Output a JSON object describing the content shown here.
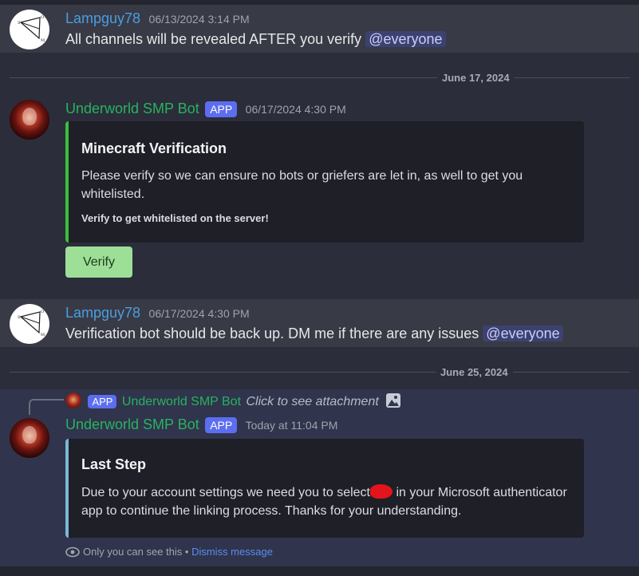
{
  "messages": [
    {
      "author": "Lampguy78",
      "timestamp": "06/13/2024 3:14 PM",
      "text": "All channels will be revealed AFTER you verify",
      "mention": "@everyone"
    },
    {
      "author": "Underworld SMP Bot",
      "tag": "APP",
      "timestamp": "06/17/2024 4:30 PM",
      "embed": {
        "title": "Minecraft Verification",
        "description": "Please verify so we can ensure no bots or griefers are let in, as well to get you whitelisted.",
        "footer": "Verify to get whitelisted on the server!",
        "accent": "#3bbf3b"
      },
      "button": "Verify"
    },
    {
      "author": "Lampguy78",
      "timestamp": "06/17/2024 4:30 PM",
      "text": "Verification bot should be back up. DM me if there are any issues",
      "mention": "@everyone"
    },
    {
      "author": "Underworld SMP Bot",
      "tag": "APP",
      "timestamp": "Today at 11:04 PM",
      "reply": {
        "tag": "APP",
        "author": "Underworld SMP Bot",
        "text": "Click to see attachment",
        "icon": "image-icon"
      },
      "embed": {
        "title": "Last Step",
        "description_before": "Due to your account settings we need you to select",
        "description_after": "in your Microsoft authenticator app to continue the linking process. Thanks for your understanding.",
        "accent": "#7ab8d8"
      },
      "ephemeral": {
        "icon": "eye-icon",
        "text": "Only you can see this •",
        "link": "Dismiss message"
      }
    }
  ],
  "dividers": [
    "June 17, 2024",
    "June 25, 2024"
  ],
  "colors": {
    "background": "#2b2d3a",
    "lampguy_name": "#4a9ee0",
    "bot_name": "#27b35f",
    "app_tag": "#5c6ef0",
    "verify_button": "#9ddf97",
    "link": "#5b8df0"
  }
}
